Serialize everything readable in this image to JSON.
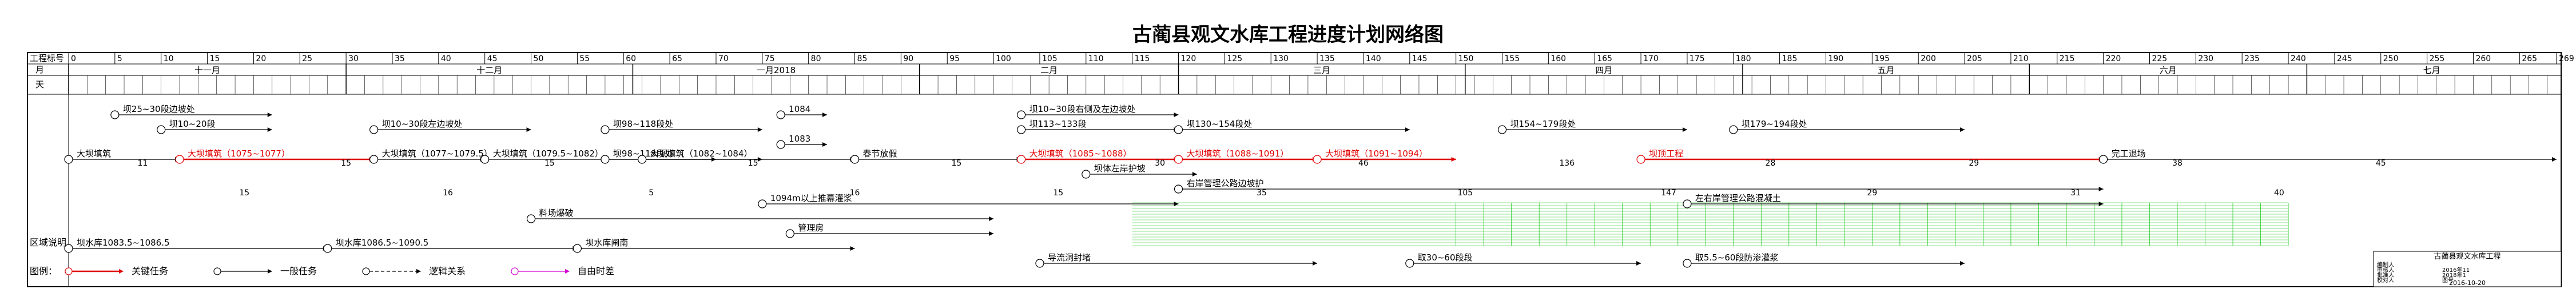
{
  "title": "古蔺县观文水库工程进度计划网络图",
  "header": {
    "row_labels": {
      "days": "工程标号",
      "month": "月",
      "day": "天"
    },
    "day_ticks": [
      "0",
      "5",
      "10",
      "15",
      "20",
      "25",
      "30",
      "35",
      "40",
      "45",
      "50",
      "55",
      "60",
      "65",
      "70",
      "75",
      "80",
      "85",
      "90",
      "95",
      "100",
      "105",
      "110",
      "115",
      "120",
      "125",
      "130",
      "135",
      "140",
      "145",
      "150",
      "155",
      "160",
      "165",
      "170",
      "175",
      "180",
      "185",
      "190",
      "195",
      "200",
      "205",
      "210",
      "215",
      "220",
      "225",
      "230",
      "235",
      "240",
      "245",
      "250",
      "255",
      "260",
      "265",
      "269"
    ],
    "months": [
      {
        "label": "十一月",
        "start": 0,
        "end": 30
      },
      {
        "label": "十二月",
        "start": 30,
        "end": 61
      },
      {
        "label": "一月2018",
        "start": 61,
        "end": 92
      },
      {
        "label": "二月",
        "start": 92,
        "end": 120
      },
      {
        "label": "三月",
        "start": 120,
        "end": 151
      },
      {
        "label": "四月",
        "start": 151,
        "end": 181
      },
      {
        "label": "五月",
        "start": 181,
        "end": 212
      },
      {
        "label": "六月",
        "start": 212,
        "end": 242
      },
      {
        "label": "七月",
        "start": 242,
        "end": 269
      }
    ]
  },
  "region_label": "区域说明",
  "tasks": [
    {
      "label": "坝25~30段边坡处",
      "day_start": 5,
      "day_end": 22,
      "lane": 1,
      "type": "normal"
    },
    {
      "label": "坝10~20段",
      "day_start": 10,
      "day_end": 22,
      "lane": 2,
      "type": "normal"
    },
    {
      "label": "坝10~30段左边坡处",
      "day_start": 33,
      "day_end": 50,
      "lane": 2,
      "type": "normal"
    },
    {
      "label": "坝98~118段处",
      "day_start": 58,
      "day_end": 75,
      "lane": 2,
      "type": "normal"
    },
    {
      "label": "1084",
      "day_start": 77,
      "day_end": 82,
      "lane": 1,
      "type": "normal"
    },
    {
      "label": "1083",
      "day_start": 77,
      "day_end": 82,
      "lane": 3,
      "type": "normal"
    },
    {
      "label": "坝10~30段右侧及左边坡处",
      "day_start": 103,
      "day_end": 120,
      "lane": 1,
      "type": "normal"
    },
    {
      "label": "坝113~133段",
      "day_start": 103,
      "day_end": 120,
      "lane": 2,
      "type": "normal"
    },
    {
      "label": "坝130~154段处",
      "day_start": 120,
      "day_end": 145,
      "lane": 2,
      "type": "normal"
    },
    {
      "label": "坝154~179段处",
      "day_start": 155,
      "day_end": 175,
      "lane": 2,
      "type": "normal"
    },
    {
      "label": "坝179~194段处",
      "day_start": 180,
      "day_end": 205,
      "lane": 2,
      "type": "normal"
    },
    {
      "label": "大坝填筑",
      "day_start": 0,
      "day_end": 12,
      "lane": 4,
      "type": "normal"
    },
    {
      "label": "大坝填筑（1075~1077）",
      "day_start": 12,
      "day_end": 33,
      "lane": 4,
      "type": "critical"
    },
    {
      "label": "大坝填筑（1077~1079.5）",
      "day_start": 33,
      "day_end": 45,
      "lane": 4,
      "type": "normal"
    },
    {
      "label": "大坝填筑（1079.5~1082）",
      "day_start": 45,
      "day_end": 70,
      "lane": 4,
      "type": "normal"
    },
    {
      "label": "坝98~118段处",
      "day_start": 58,
      "day_end": 75,
      "lane": 4,
      "type": "normal"
    },
    {
      "label": "大坝填筑（1082~1084）",
      "day_start": 62,
      "day_end": 85,
      "lane": 4,
      "type": "normal"
    },
    {
      "label": "春节放假",
      "day_start": 85,
      "day_end": 103,
      "lane": 4,
      "type": "normal"
    },
    {
      "label": "大坝填筑（1085~1088）",
      "day_start": 103,
      "day_end": 120,
      "lane": 4,
      "type": "critical"
    },
    {
      "label": "大坝填筑（1088~1091）",
      "day_start": 120,
      "day_end": 135,
      "lane": 4,
      "type": "critical"
    },
    {
      "label": "大坝填筑（1091~1094）",
      "day_start": 135,
      "day_end": 150,
      "lane": 4,
      "type": "critical"
    },
    {
      "label": "坝顶工程",
      "day_start": 170,
      "day_end": 220,
      "lane": 4,
      "type": "critical"
    },
    {
      "label": "完工退场",
      "day_start": 220,
      "day_end": 269,
      "lane": 4,
      "type": "normal"
    },
    {
      "label": "坝体左岸护坡",
      "day_start": 110,
      "day_end": 122,
      "lane": 5,
      "type": "normal"
    },
    {
      "label": "右岸管理公路边坡护",
      "day_start": 120,
      "day_end": 220,
      "lane": 6,
      "type": "normal"
    },
    {
      "label": "左右岸管理公路混凝土",
      "day_start": 175,
      "day_end": 220,
      "lane": 7,
      "type": "normal"
    },
    {
      "label": "1094m以上推幕灌浆",
      "day_start": 75,
      "day_end": 120,
      "lane": 7,
      "type": "normal"
    },
    {
      "label": "料场爆破",
      "day_start": 50,
      "day_end": 100,
      "lane": 8,
      "type": "normal"
    },
    {
      "label": "管理房",
      "day_start": 78,
      "day_end": 100,
      "lane": 9,
      "type": "normal"
    },
    {
      "label": "坝水库1083.5~1086.5",
      "day_start": 0,
      "day_end": 28,
      "lane": 10,
      "type": "normal"
    },
    {
      "label": "坝水库1086.5~1090.5",
      "day_start": 28,
      "day_end": 55,
      "lane": 10,
      "type": "normal"
    },
    {
      "label": "坝水库闸南",
      "day_start": 55,
      "day_end": 85,
      "lane": 10,
      "type": "normal"
    },
    {
      "label": "导流洞封堵",
      "day_start": 105,
      "day_end": 135,
      "lane": 11,
      "type": "normal"
    },
    {
      "label": "取30~60段段",
      "day_start": 145,
      "day_end": 170,
      "lane": 11,
      "type": "normal"
    },
    {
      "label": "取5.5~60段防渗灌浆",
      "day_start": 175,
      "day_end": 205,
      "lane": 11,
      "type": "normal"
    }
  ],
  "duration_labels": [
    "11",
    "15",
    "15",
    "16",
    "15",
    "5",
    "15",
    "16",
    "15",
    "15",
    "30",
    "35",
    "46",
    "105",
    "136",
    "147",
    "28",
    "29",
    "29",
    "31",
    "38",
    "40",
    "45"
  ],
  "legend": {
    "title": "图例：",
    "items": [
      {
        "label": "关键任务",
        "color": "#e00000"
      },
      {
        "label": "一般任务",
        "color": "#000000"
      },
      {
        "label": "逻辑关系",
        "color": "#000000"
      },
      {
        "label": "自由时差",
        "color": "#d400d4"
      }
    ]
  },
  "title_block": {
    "project": "古蔺县观文水库工程",
    "rows": [
      {
        "label": "编制人",
        "value": ""
      },
      {
        "label": "审核人",
        "value": "2016年11"
      },
      {
        "label": "批准人",
        "value": "2018年1"
      },
      {
        "label": "校对人",
        "value": "图号"
      }
    ],
    "date": "2016-10-20"
  },
  "colors": {
    "critical": "#e00000",
    "normal": "#000000",
    "float": "#d400d4",
    "grid": "#1ec81e",
    "watermark": "#e0a000"
  }
}
